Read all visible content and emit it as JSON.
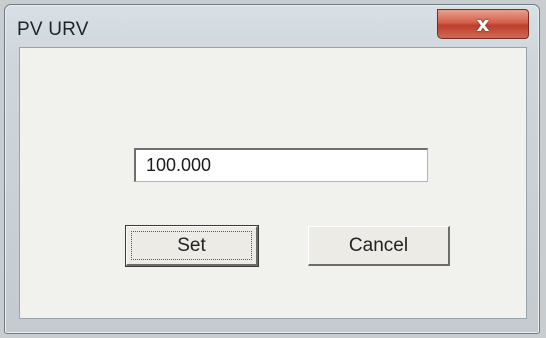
{
  "window": {
    "title": "PV URV",
    "close_glyph": "x"
  },
  "field": {
    "value": "100.000"
  },
  "buttons": {
    "set_label": "Set",
    "cancel_label": "Cancel"
  },
  "colors": {
    "close_button": "#c9503c",
    "client_background": "#f1f1ee",
    "frame": "#cfd7dd"
  },
  "icons": {
    "close": "close-icon"
  }
}
